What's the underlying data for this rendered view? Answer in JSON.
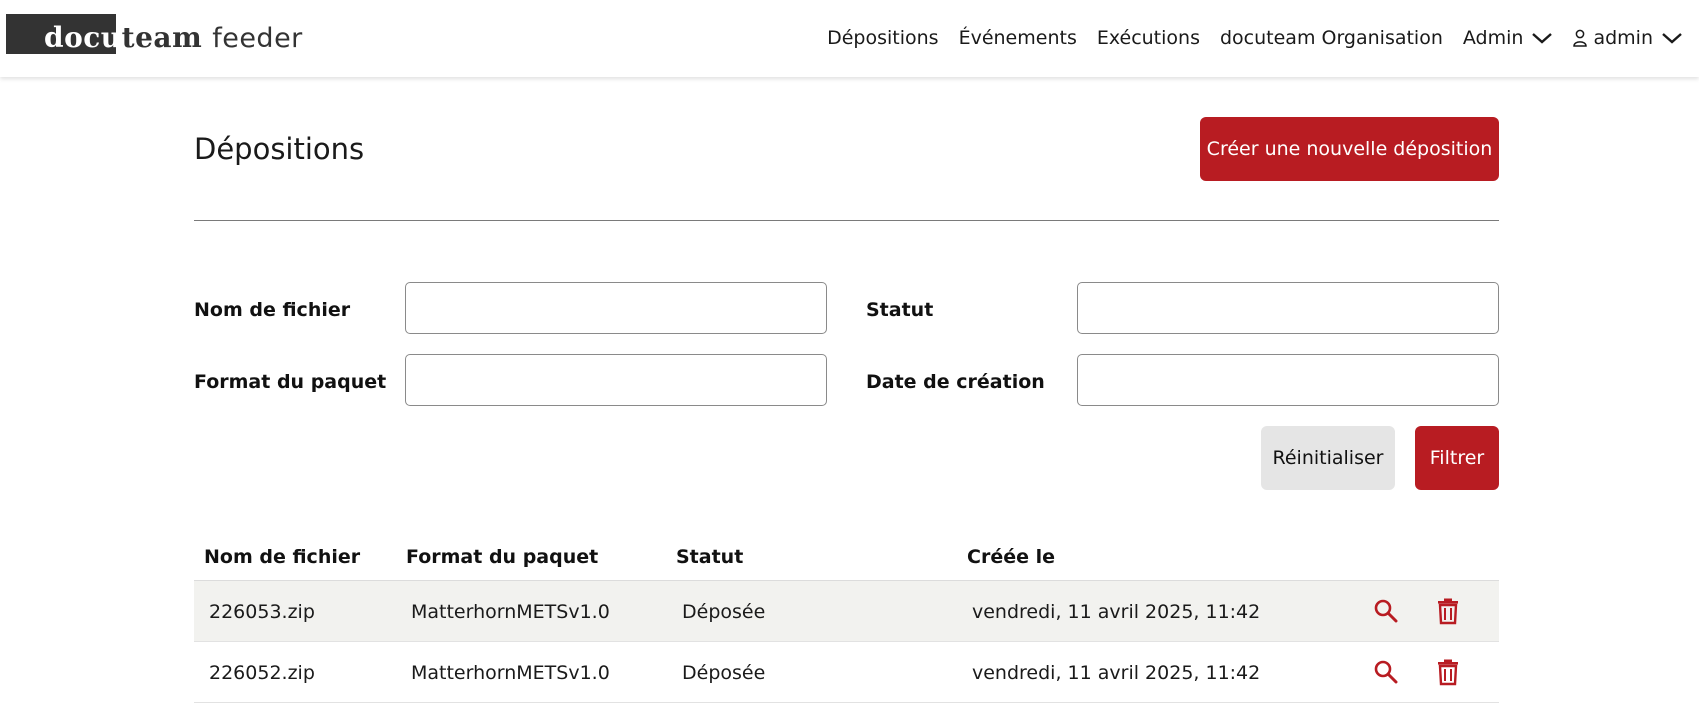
{
  "header": {
    "logo": {
      "docu": "docu",
      "team": "team",
      "feeder": "feeder"
    },
    "nav": {
      "depositions": "Dépositions",
      "events": "Événements",
      "executions": "Exécutions",
      "organisation": "docuteam Organisation",
      "admin_menu": "Admin",
      "user_menu": "admin"
    }
  },
  "page": {
    "title": "Dépositions",
    "create_button": "Créer une nouvelle déposition"
  },
  "filters": {
    "filename_label": "Nom de fichier",
    "filename_value": "",
    "status_label": "Statut",
    "status_value": "",
    "format_label": "Format du paquet",
    "format_value": "",
    "date_label": "Date de création",
    "date_value": "",
    "reset_button": "Réinitialiser",
    "filter_button": "Filtrer"
  },
  "table": {
    "headers": {
      "filename": "Nom de fichier",
      "format": "Format du paquet",
      "status": "Statut",
      "created": "Créée le"
    },
    "rows": [
      {
        "filename": "226053.zip",
        "format": "MatterhornMETSv1.0",
        "status": "Déposée",
        "created": "vendredi, 11 avril 2025, 11:42"
      },
      {
        "filename": "226052.zip",
        "format": "MatterhornMETSv1.0",
        "status": "Déposée",
        "created": "vendredi, 11 avril 2025, 11:42"
      }
    ]
  },
  "icons": {
    "view": "search-icon",
    "delete": "trash-icon",
    "user": "user-icon",
    "dropdown": "chevron-down-icon"
  },
  "colors": {
    "accent": "#b81c22",
    "logo_dark": "#333333",
    "row_stripe": "#f2f2ef"
  }
}
